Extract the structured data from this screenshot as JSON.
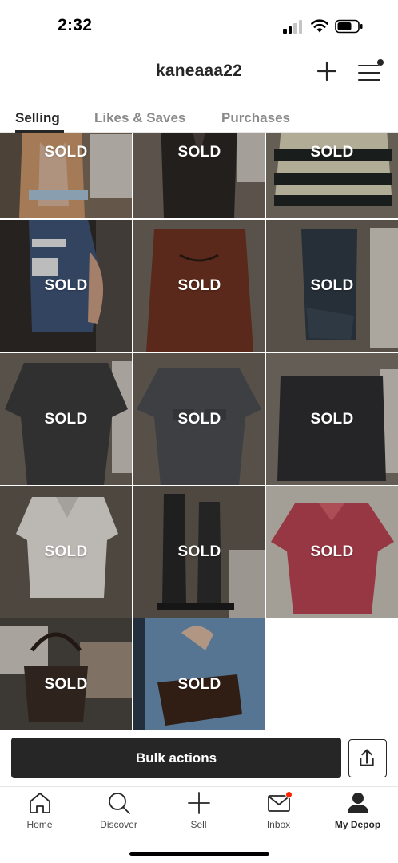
{
  "status_bar": {
    "time": "2:32"
  },
  "header": {
    "username": "kaneaaa22"
  },
  "tabs": [
    {
      "label": "Selling"
    },
    {
      "label": "Likes & Saves"
    },
    {
      "label": "Purchases"
    }
  ],
  "listings": [
    {
      "status": "SOLD"
    },
    {
      "status": "SOLD"
    },
    {
      "status": "SOLD"
    },
    {
      "status": "SOLD"
    },
    {
      "status": "SOLD"
    },
    {
      "status": "SOLD"
    },
    {
      "status": "SOLD"
    },
    {
      "status": "SOLD"
    },
    {
      "status": "SOLD"
    },
    {
      "status": "SOLD"
    },
    {
      "status": "SOLD"
    },
    {
      "status": "SOLD"
    },
    {
      "status": "SOLD"
    },
    {
      "status": "SOLD"
    }
  ],
  "actions": {
    "bulk_label": "Bulk actions"
  },
  "nav": [
    {
      "label": "Home",
      "icon": "home-icon"
    },
    {
      "label": "Discover",
      "icon": "search-icon"
    },
    {
      "label": "Sell",
      "icon": "plus-icon"
    },
    {
      "label": "Inbox",
      "icon": "mail-icon"
    },
    {
      "label": "My Depop",
      "icon": "profile-icon"
    }
  ],
  "colors": {
    "primary": "#262626",
    "notification": "#ff2300",
    "inactive_tab": "#8a8a8a"
  }
}
